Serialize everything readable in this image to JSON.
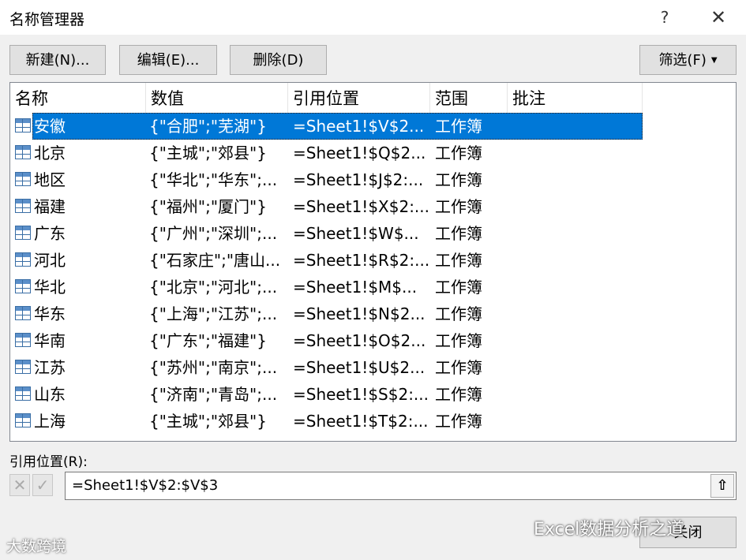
{
  "window": {
    "title": "名称管理器",
    "help_label": "?",
    "close_label": "✕"
  },
  "toolbar": {
    "new_label": "新建(N)...",
    "edit_label": "编辑(E)...",
    "delete_label": "删除(D)",
    "filter_label": "筛选(F)"
  },
  "table": {
    "headers": {
      "name": "名称",
      "value": "数值",
      "ref": "引用位置",
      "scope": "范围",
      "comment": "批注"
    },
    "rows": [
      {
        "name": "安徽",
        "value": "{\"合肥\";\"芜湖\"}",
        "ref": "=Sheet1!$V$2...",
        "scope": "工作簿",
        "selected": true
      },
      {
        "name": "北京",
        "value": "{\"主城\";\"郊县\"}",
        "ref": "=Sheet1!$Q$2...",
        "scope": "工作簿"
      },
      {
        "name": "地区",
        "value": "{\"华北\";\"华东\";...",
        "ref": "=Sheet1!$J$2:...",
        "scope": "工作簿"
      },
      {
        "name": "福建",
        "value": "{\"福州\";\"厦门\"}",
        "ref": "=Sheet1!$X$2:...",
        "scope": "工作簿"
      },
      {
        "name": "广东",
        "value": "{\"广州\";\"深圳\";...",
        "ref": "=Sheet1!$W$...",
        "scope": "工作簿"
      },
      {
        "name": "河北",
        "value": "{\"石家庄\";\"唐山...",
        "ref": "=Sheet1!$R$2:...",
        "scope": "工作簿"
      },
      {
        "name": "华北",
        "value": "{\"北京\";\"河北\";...",
        "ref": "=Sheet1!$M$...",
        "scope": "工作簿"
      },
      {
        "name": "华东",
        "value": "{\"上海\";\"江苏\";...",
        "ref": "=Sheet1!$N$2...",
        "scope": "工作簿"
      },
      {
        "name": "华南",
        "value": "{\"广东\";\"福建\"}",
        "ref": "=Sheet1!$O$2...",
        "scope": "工作簿"
      },
      {
        "name": "江苏",
        "value": "{\"苏州\";\"南京\";...",
        "ref": "=Sheet1!$U$2...",
        "scope": "工作簿"
      },
      {
        "name": "山东",
        "value": "{\"济南\";\"青岛\";...",
        "ref": "=Sheet1!$S$2:...",
        "scope": "工作簿"
      },
      {
        "name": "上海",
        "value": "{\"主城\";\"郊县\"}",
        "ref": "=Sheet1!$T$2:...",
        "scope": "工作簿"
      }
    ]
  },
  "refers_to": {
    "label": "引用位置(R):",
    "value": "=Sheet1!$V$2:$V$3",
    "cancel_icon": "✕",
    "ok_icon": "✓",
    "collapse_icon": "⇧"
  },
  "footer": {
    "close_label": "关闭"
  },
  "watermarks": {
    "right": "Excel数据分析之道",
    "left": "大数跨境"
  },
  "colors": {
    "selection": "#0078d7",
    "button_bg": "#e1e1e1",
    "dialog_bg": "#f0f0f0"
  }
}
